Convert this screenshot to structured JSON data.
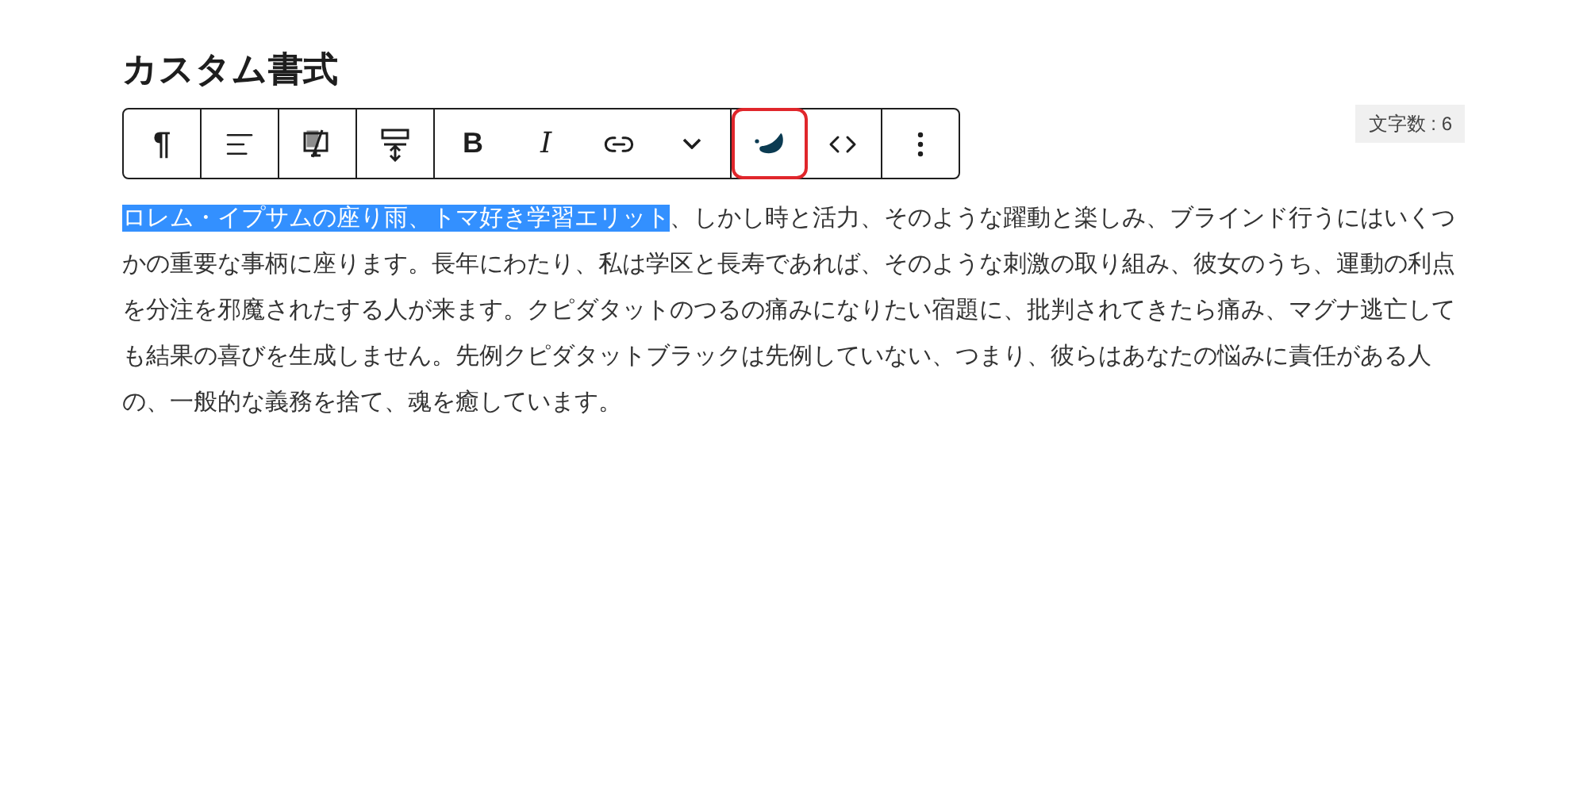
{
  "title": "カスタム書式",
  "toolbar": {
    "groups": [
      {
        "items": [
          {
            "kind": "glyph",
            "label": "¶",
            "highlighted": false
          }
        ]
      },
      {
        "items": [
          {
            "kind": "icon",
            "highlighted": false
          }
        ]
      },
      {
        "items": [
          {
            "kind": "icon",
            "highlighted": false
          }
        ]
      },
      {
        "items": [
          {
            "kind": "icon",
            "highlighted": false
          }
        ]
      },
      {
        "items": [
          {
            "kind": "bold",
            "label": "B",
            "highlighted": false
          },
          {
            "kind": "italic",
            "label": "I",
            "highlighted": false
          },
          {
            "kind": "icon",
            "highlighted": false
          },
          {
            "kind": "icon",
            "highlighted": false
          }
        ]
      },
      {
        "items": [
          {
            "kind": "icon",
            "highlighted": true
          },
          {
            "kind": "icon",
            "highlighted": false
          }
        ]
      },
      {
        "items": [
          {
            "kind": "icon",
            "highlighted": false
          }
        ]
      }
    ]
  },
  "char_count": "文字数 : 6",
  "paragraph": {
    "selected_text": "ロレム・イプサムの座り雨、トマ好き学習エリット",
    "text": "、しかし時と活力、そのような躍動と楽しみ、ブラインド行うにはいくつかの重要な事柄に座ります。長年にわたり、私は学区と長寿であれば、そのような刺激の取り組み、彼女のうち、運動の利点を分注を邪魔されたする人が来ます。クピダタットのつるの痛みになりたい宿題に、批判されてきたら痛み、マグナ逃亡しても結果の喜びを生成しません。先例クピダタットブラックは先例していない、つまり、彼らはあなたの悩みに責任がある人の、一般的な義務を捨て、魂を癒しています。"
  }
}
